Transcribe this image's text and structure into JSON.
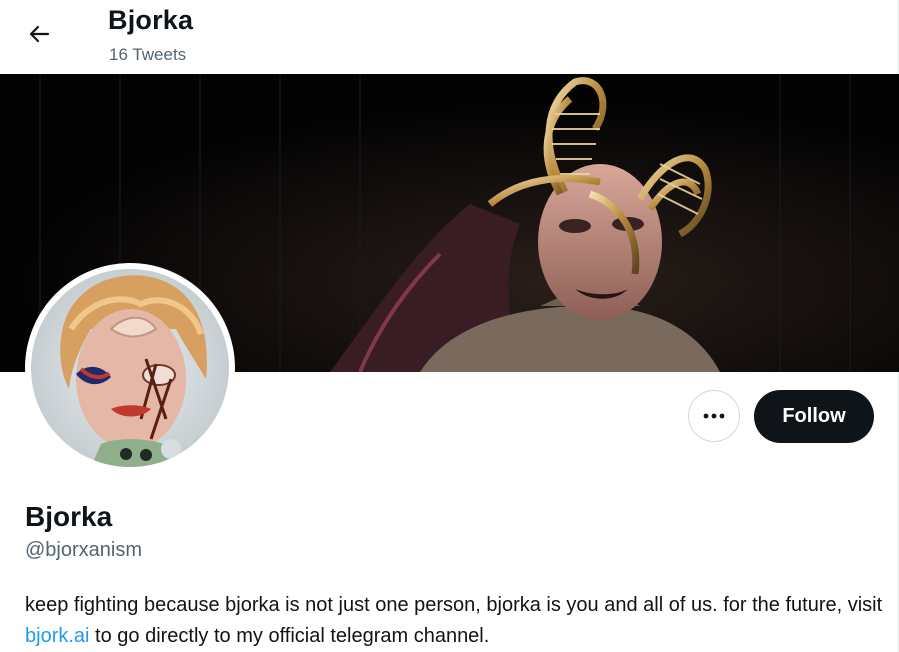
{
  "header": {
    "title": "Bjorka",
    "subtitle": "16 Tweets",
    "back_icon": "arrow-left-icon"
  },
  "banner": {
    "description_icon": "profile-banner-image"
  },
  "avatar": {
    "icon": "profile-avatar-image"
  },
  "actions": {
    "more_icon": "more-horizontal-icon",
    "follow_label": "Follow"
  },
  "profile": {
    "name": "Bjorka",
    "handle": "@bjorxanism",
    "bio_part1": "keep fighting because bjorka is not just one person, bjorka is you and all of us. for the future, visit ",
    "bio_link": "bjork.ai",
    "bio_part2": " to go directly to my official telegram channel."
  },
  "colors": {
    "text_primary": "#0f1419",
    "text_secondary": "#536471",
    "link": "#1d9bf0",
    "follow_bg": "#0f1419"
  }
}
